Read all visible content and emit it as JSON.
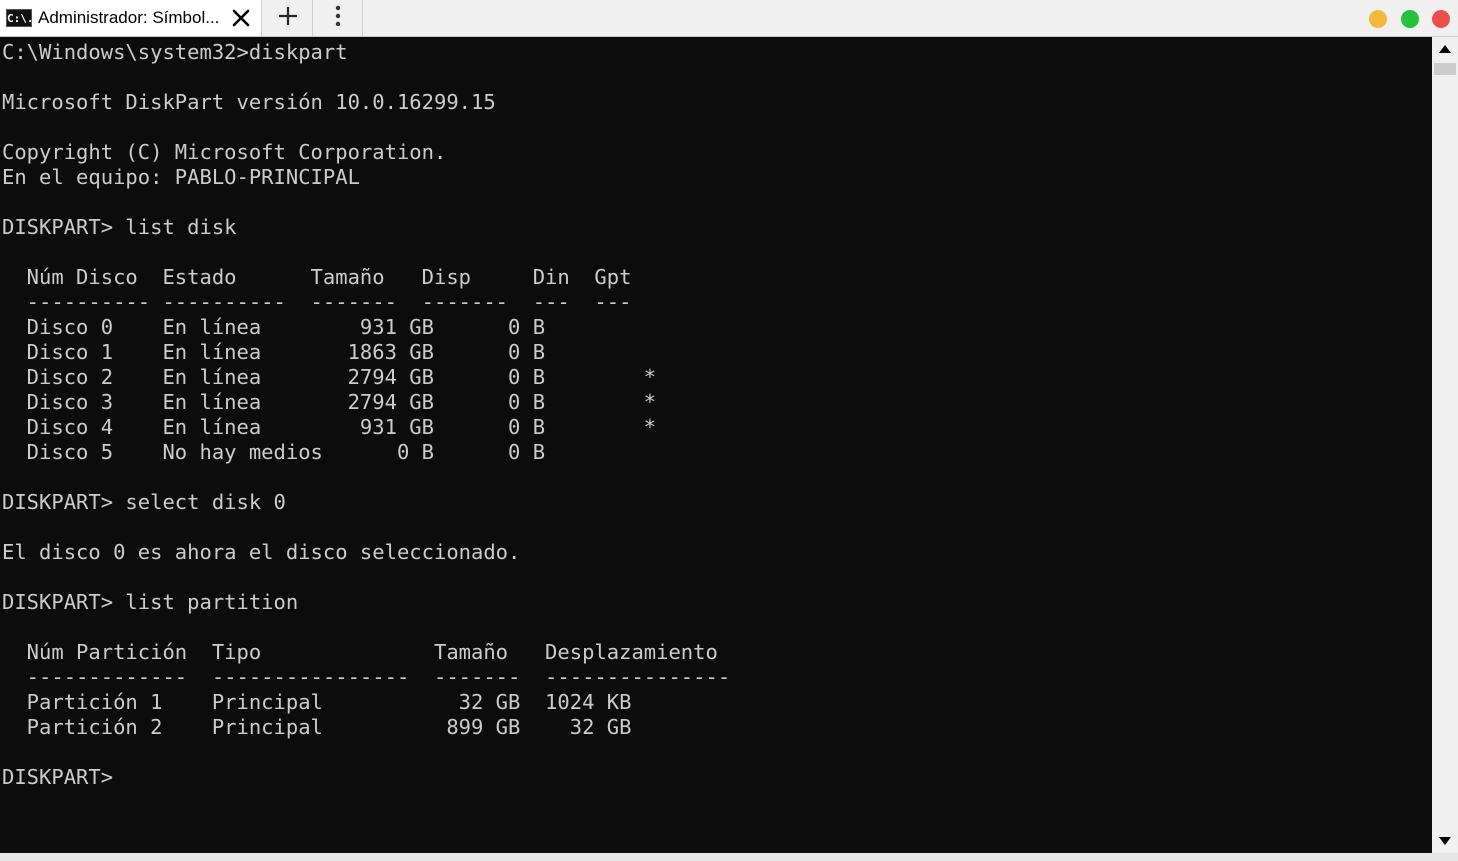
{
  "tab": {
    "icon_text": "C:\\.",
    "title": "Administrador: Símbol..."
  },
  "colors": {
    "console_bg": "#0c0c0c",
    "console_text": "#cccccc",
    "traffic_yellow": "#f6b73c",
    "traffic_green": "#25c23a",
    "traffic_red": "#ee4d4d"
  },
  "icons": {
    "close": "close-icon",
    "new_tab": "plus-icon",
    "menu": "vertical-dots-icon",
    "scroll_up": "triangle-up-icon",
    "scroll_down": "triangle-down-icon"
  },
  "console": {
    "lines": [
      "C:\\Windows\\system32>diskpart",
      "",
      "Microsoft DiskPart versión 10.0.16299.15",
      "",
      "Copyright (C) Microsoft Corporation.",
      "En el equipo: PABLO-PRINCIPAL",
      "",
      "DISKPART> list disk",
      "",
      "  Núm Disco  Estado      Tamaño   Disp     Din  Gpt",
      "  ---------- ----------  -------  -------  ---  ---",
      "  Disco 0    En línea        931 GB      0 B",
      "  Disco 1    En línea       1863 GB      0 B",
      "  Disco 2    En línea       2794 GB      0 B        *",
      "  Disco 3    En línea       2794 GB      0 B        *",
      "  Disco 4    En línea        931 GB      0 B        *",
      "  Disco 5    No hay medios      0 B      0 B",
      "",
      "DISKPART> select disk 0",
      "",
      "El disco 0 es ahora el disco seleccionado.",
      "",
      "DISKPART> list partition",
      "",
      "  Núm Partición  Tipo              Tamaño   Desplazamiento",
      "  -------------  ----------------  -------  ---------------",
      "  Partición 1    Principal           32 GB  1024 KB",
      "  Partición 2    Principal          899 GB    32 GB",
      "",
      "DISKPART>"
    ]
  }
}
